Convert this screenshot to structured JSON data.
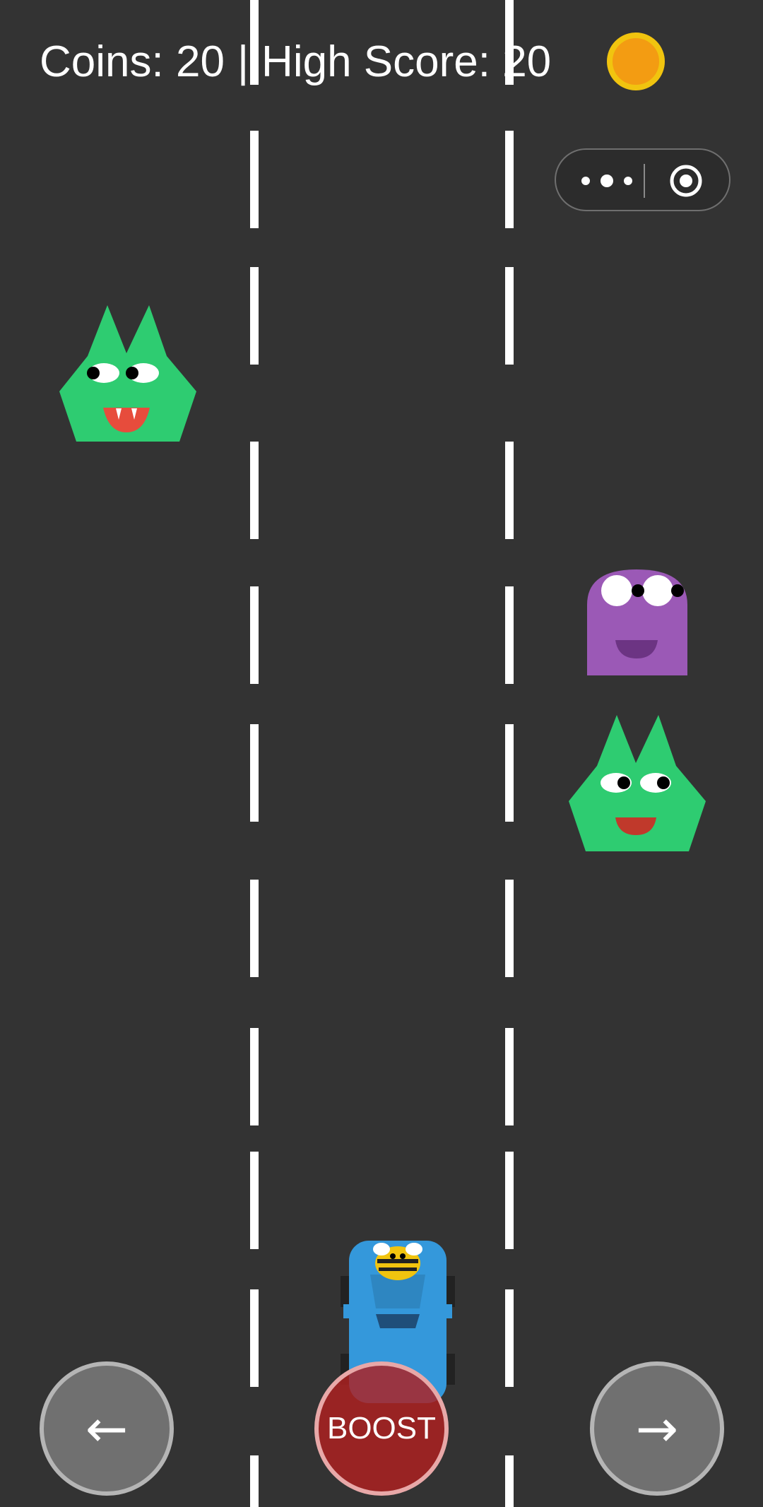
{
  "hud": {
    "coins_text": "Coins: 20",
    "separator": "|",
    "high_score_text": "High Score: 20"
  },
  "icons": {
    "coin": "coin-icon",
    "more": "more-dots-icon",
    "close": "target-circle-icon"
  },
  "controls": {
    "left_label": "←",
    "boost_label": "BOOST",
    "right_label": "→"
  },
  "colors": {
    "road": "#333333",
    "lane_marking": "#ffffff",
    "coin_fill": "#f39c12",
    "coin_rim": "#f1c40f",
    "green_monster": "#2ecc71",
    "purple_monster": "#9b59b6",
    "player_car": "#3498db",
    "boost_button": "#b02020"
  }
}
